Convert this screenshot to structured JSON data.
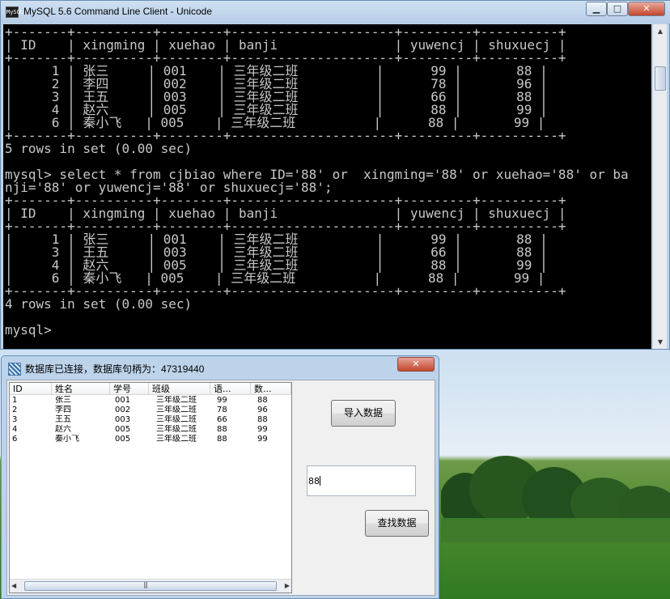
{
  "console": {
    "title": "MySQL 5.6 Command Line Client - Unicode",
    "app_icon_label": "MySQL",
    "lines": [
      "+-------+----------+--------+---------------------+---------+----------+",
      "| ID    | xingming | xuehao | banji               | yuwencj | shuxuecj |",
      "+-------+----------+--------+---------------------+---------+----------+",
      "|     1 | 张三     | 001    | 三年级二班          |      99 |       88 |",
      "|     2 | 李四     | 002    | 三年级二班          |      78 |       96 |",
      "|     3 | 王五     | 003    | 三年级二班          |      66 |       88 |",
      "|     4 | 赵六     | 005    | 三年级二班          |      88 |       99 |",
      "|     6 | 秦小飞   | 005    | 三年级二班          |      88 |       99 |",
      "+-------+----------+--------+---------------------+---------+----------+",
      "5 rows in set (0.00 sec)",
      "",
      "mysql> select * from cjbiao where ID='88' or  xingming='88' or xuehao='88' or ba",
      "nji='88' or yuwencj='88' or shuxuecj='88';",
      "+-------+----------+--------+---------------------+---------+----------+",
      "| ID    | xingming | xuehao | banji               | yuwencj | shuxuecj |",
      "+-------+----------+--------+---------------------+---------+----------+",
      "|     1 | 张三     | 001    | 三年级二班          |      99 |       88 |",
      "|     3 | 王五     | 003    | 三年级二班          |      66 |       88 |",
      "|     4 | 赵六     | 005    | 三年级二班          |      88 |       99 |",
      "|     6 | 秦小飞   | 005    | 三年级二班          |      88 |       99 |",
      "+-------+----------+--------+---------------------+---------+----------+",
      "4 rows in set (0.00 sec)",
      "",
      "mysql>"
    ]
  },
  "dialog": {
    "title": "数据库已连接，数据库句柄为：47319440",
    "columns": [
      "ID",
      "姓名",
      "学号",
      "班级",
      "语...",
      "数..."
    ],
    "rows": [
      [
        "1",
        "张三",
        "001",
        "三年级二班",
        "99",
        "88"
      ],
      [
        "2",
        "李四",
        "002",
        "三年级二班",
        "78",
        "96"
      ],
      [
        "3",
        "王五",
        "003",
        "三年级二班",
        "66",
        "88"
      ],
      [
        "4",
        "赵六",
        "005",
        "三年级二班",
        "88",
        "99"
      ],
      [
        "6",
        "秦小飞",
        "005",
        "三年级二班",
        "88",
        "99"
      ]
    ],
    "import_button": "导入数据",
    "search_value": "88",
    "search_button": "查找数据"
  },
  "icons": {
    "minimize": "minimize-icon",
    "maximize": "maximize-icon",
    "close": "close-icon",
    "scroll_up": "up-arrow-icon",
    "scroll_down": "down-arrow-icon",
    "scroll_left": "left-arrow-icon",
    "scroll_right": "right-arrow-icon"
  },
  "colors": {
    "console_bg": "#000000",
    "console_text": "#c8c8c8",
    "window_frame": "#bcd3ea",
    "close_button": "#c5462f"
  }
}
